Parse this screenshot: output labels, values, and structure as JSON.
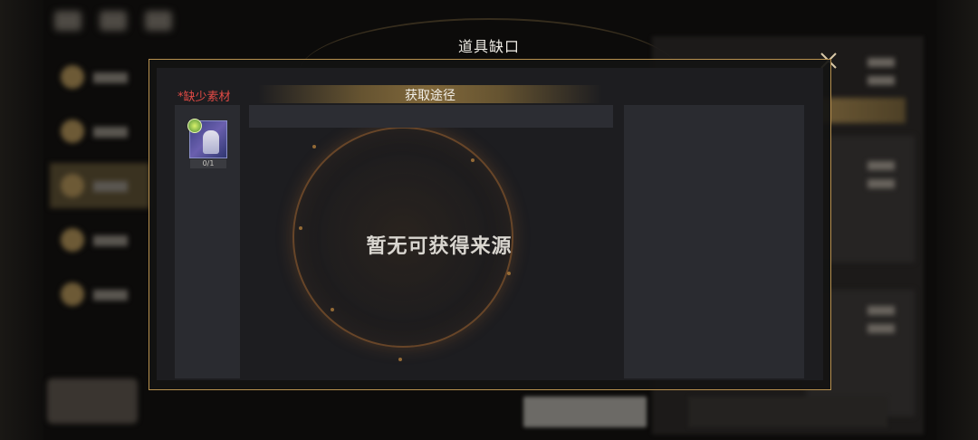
{
  "dialog": {
    "title": "道具缺口",
    "close_icon": "close-icon",
    "missing_label": "*缺少素材",
    "section_header": "获取途径",
    "empty_message": "暂无可获得来源"
  },
  "items": [
    {
      "icon": "character-card-icon",
      "count": "0/1"
    }
  ],
  "colors": {
    "accent_gold": "#b8914f",
    "missing_red": "#e04a45",
    "panel_bg": "#1d1d20",
    "column_bg": "#2a2b30"
  }
}
